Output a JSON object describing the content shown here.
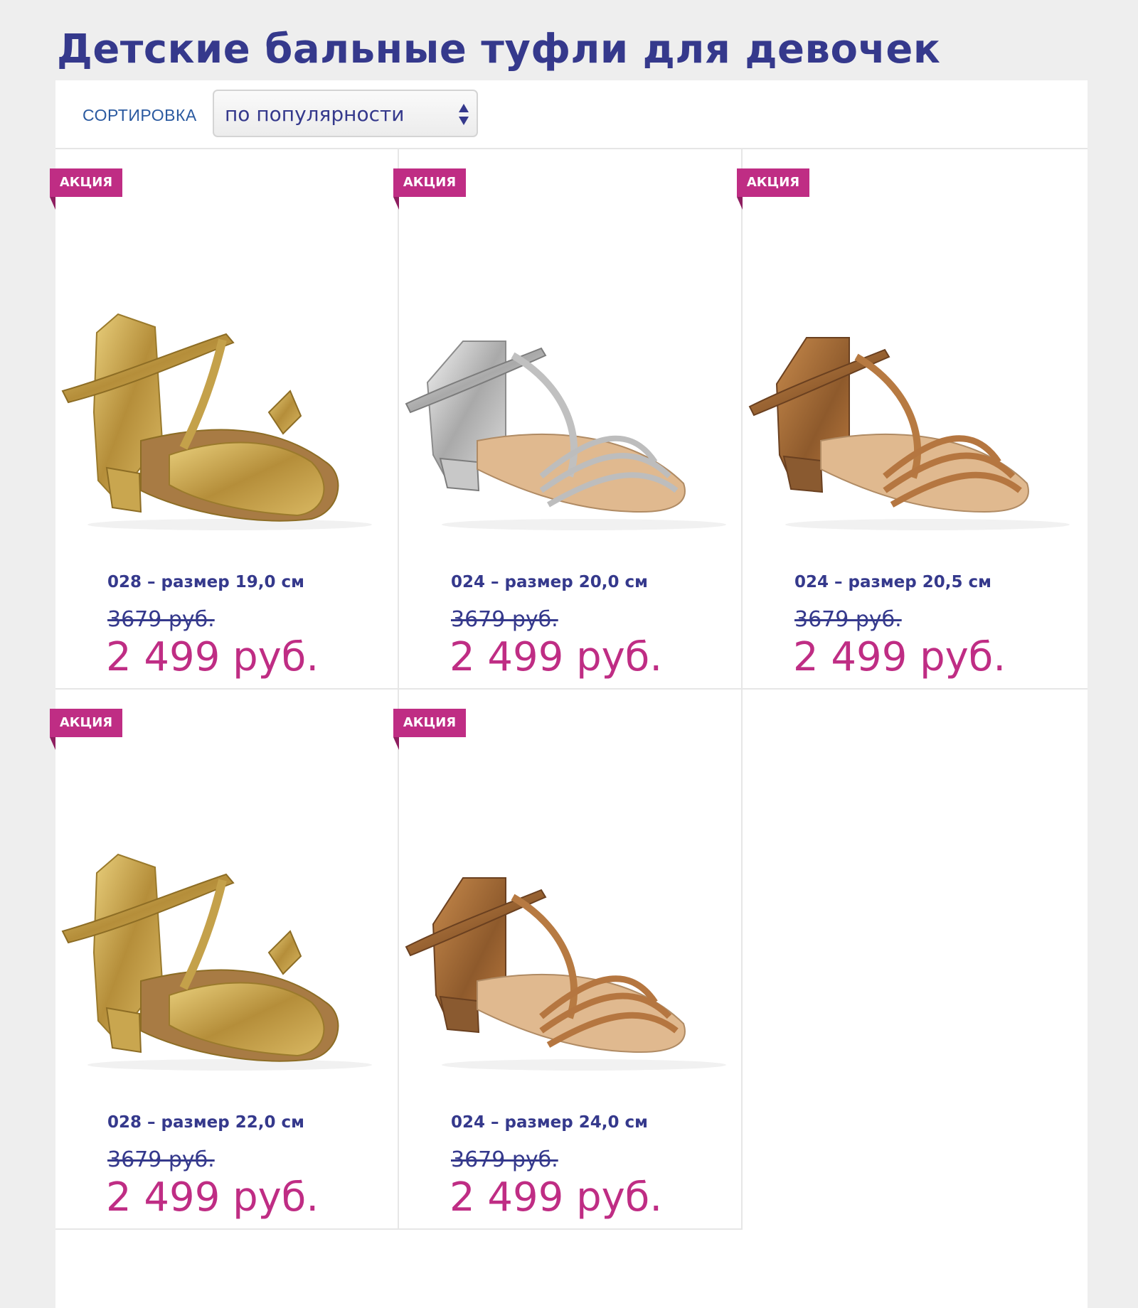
{
  "page": {
    "title": "Детские бальные туфли для девочек"
  },
  "sort": {
    "label": "СОРТИРОВКА",
    "value": "по популярности"
  },
  "colors": {
    "accent": "#bf2d84",
    "brand": "#35398c",
    "background": "#eeeeee"
  },
  "products": [
    {
      "badge": "АКЦИЯ",
      "name": "028 – размер 19,0 см",
      "old_price": "3679 руб.",
      "price": "2 499 руб.",
      "image": "gold-sandal-icon",
      "tone": "gold"
    },
    {
      "badge": "АКЦИЯ",
      "name": "024 – размер 20,0 см",
      "old_price": "3679 руб.",
      "price": "2 499 руб.",
      "image": "silver-sandal-icon",
      "tone": "silver"
    },
    {
      "badge": "АКЦИЯ",
      "name": "024 – размер 20,5 см",
      "old_price": "3679 руб.",
      "price": "2 499 руб.",
      "image": "tan-sandal-icon",
      "tone": "tan"
    },
    {
      "badge": "АКЦИЯ",
      "name": "028 – размер 22,0 см",
      "old_price": "3679 руб.",
      "price": "2 499 руб.",
      "image": "gold-sandal-icon",
      "tone": "gold"
    },
    {
      "badge": "АКЦИЯ",
      "name": "024 – размер 24,0 см",
      "old_price": "3679 руб.",
      "price": "2 499 руб.",
      "image": "tan-sandal-icon",
      "tone": "tan"
    }
  ]
}
